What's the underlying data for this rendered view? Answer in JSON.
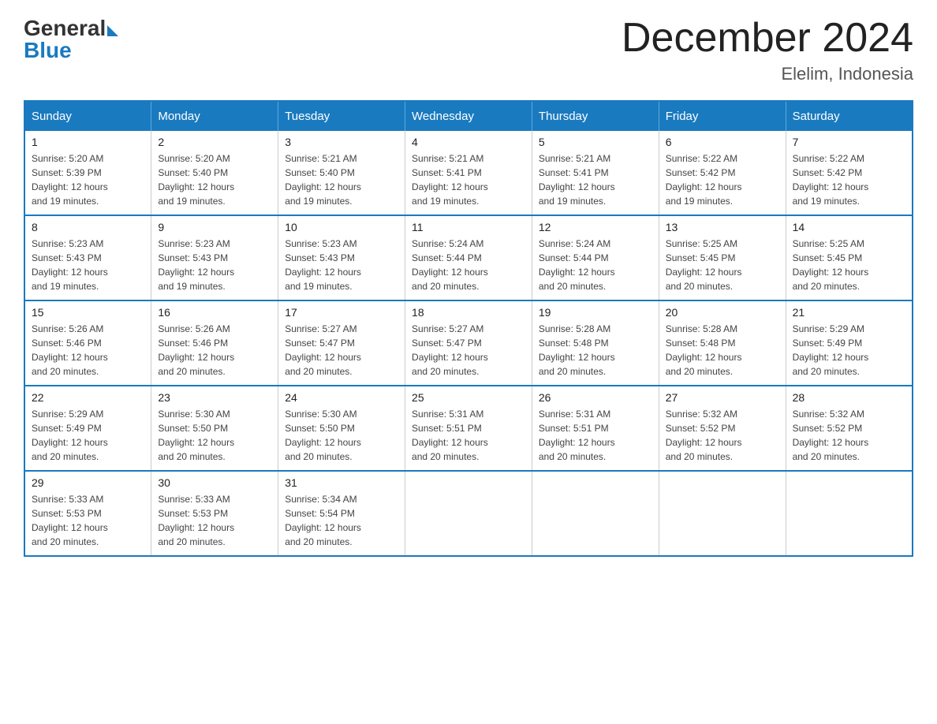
{
  "header": {
    "logo_general": "General",
    "logo_blue": "Blue",
    "title": "December 2024",
    "location": "Elelim, Indonesia"
  },
  "days_of_week": [
    "Sunday",
    "Monday",
    "Tuesday",
    "Wednesday",
    "Thursday",
    "Friday",
    "Saturday"
  ],
  "weeks": [
    [
      {
        "day": "1",
        "sunrise": "5:20 AM",
        "sunset": "5:39 PM",
        "daylight": "12 hours and 19 minutes."
      },
      {
        "day": "2",
        "sunrise": "5:20 AM",
        "sunset": "5:40 PM",
        "daylight": "12 hours and 19 minutes."
      },
      {
        "day": "3",
        "sunrise": "5:21 AM",
        "sunset": "5:40 PM",
        "daylight": "12 hours and 19 minutes."
      },
      {
        "day": "4",
        "sunrise": "5:21 AM",
        "sunset": "5:41 PM",
        "daylight": "12 hours and 19 minutes."
      },
      {
        "day": "5",
        "sunrise": "5:21 AM",
        "sunset": "5:41 PM",
        "daylight": "12 hours and 19 minutes."
      },
      {
        "day": "6",
        "sunrise": "5:22 AM",
        "sunset": "5:42 PM",
        "daylight": "12 hours and 19 minutes."
      },
      {
        "day": "7",
        "sunrise": "5:22 AM",
        "sunset": "5:42 PM",
        "daylight": "12 hours and 19 minutes."
      }
    ],
    [
      {
        "day": "8",
        "sunrise": "5:23 AM",
        "sunset": "5:43 PM",
        "daylight": "12 hours and 19 minutes."
      },
      {
        "day": "9",
        "sunrise": "5:23 AM",
        "sunset": "5:43 PM",
        "daylight": "12 hours and 19 minutes."
      },
      {
        "day": "10",
        "sunrise": "5:23 AM",
        "sunset": "5:43 PM",
        "daylight": "12 hours and 19 minutes."
      },
      {
        "day": "11",
        "sunrise": "5:24 AM",
        "sunset": "5:44 PM",
        "daylight": "12 hours and 20 minutes."
      },
      {
        "day": "12",
        "sunrise": "5:24 AM",
        "sunset": "5:44 PM",
        "daylight": "12 hours and 20 minutes."
      },
      {
        "day": "13",
        "sunrise": "5:25 AM",
        "sunset": "5:45 PM",
        "daylight": "12 hours and 20 minutes."
      },
      {
        "day": "14",
        "sunrise": "5:25 AM",
        "sunset": "5:45 PM",
        "daylight": "12 hours and 20 minutes."
      }
    ],
    [
      {
        "day": "15",
        "sunrise": "5:26 AM",
        "sunset": "5:46 PM",
        "daylight": "12 hours and 20 minutes."
      },
      {
        "day": "16",
        "sunrise": "5:26 AM",
        "sunset": "5:46 PM",
        "daylight": "12 hours and 20 minutes."
      },
      {
        "day": "17",
        "sunrise": "5:27 AM",
        "sunset": "5:47 PM",
        "daylight": "12 hours and 20 minutes."
      },
      {
        "day": "18",
        "sunrise": "5:27 AM",
        "sunset": "5:47 PM",
        "daylight": "12 hours and 20 minutes."
      },
      {
        "day": "19",
        "sunrise": "5:28 AM",
        "sunset": "5:48 PM",
        "daylight": "12 hours and 20 minutes."
      },
      {
        "day": "20",
        "sunrise": "5:28 AM",
        "sunset": "5:48 PM",
        "daylight": "12 hours and 20 minutes."
      },
      {
        "day": "21",
        "sunrise": "5:29 AM",
        "sunset": "5:49 PM",
        "daylight": "12 hours and 20 minutes."
      }
    ],
    [
      {
        "day": "22",
        "sunrise": "5:29 AM",
        "sunset": "5:49 PM",
        "daylight": "12 hours and 20 minutes."
      },
      {
        "day": "23",
        "sunrise": "5:30 AM",
        "sunset": "5:50 PM",
        "daylight": "12 hours and 20 minutes."
      },
      {
        "day": "24",
        "sunrise": "5:30 AM",
        "sunset": "5:50 PM",
        "daylight": "12 hours and 20 minutes."
      },
      {
        "day": "25",
        "sunrise": "5:31 AM",
        "sunset": "5:51 PM",
        "daylight": "12 hours and 20 minutes."
      },
      {
        "day": "26",
        "sunrise": "5:31 AM",
        "sunset": "5:51 PM",
        "daylight": "12 hours and 20 minutes."
      },
      {
        "day": "27",
        "sunrise": "5:32 AM",
        "sunset": "5:52 PM",
        "daylight": "12 hours and 20 minutes."
      },
      {
        "day": "28",
        "sunrise": "5:32 AM",
        "sunset": "5:52 PM",
        "daylight": "12 hours and 20 minutes."
      }
    ],
    [
      {
        "day": "29",
        "sunrise": "5:33 AM",
        "sunset": "5:53 PM",
        "daylight": "12 hours and 20 minutes."
      },
      {
        "day": "30",
        "sunrise": "5:33 AM",
        "sunset": "5:53 PM",
        "daylight": "12 hours and 20 minutes."
      },
      {
        "day": "31",
        "sunrise": "5:34 AM",
        "sunset": "5:54 PM",
        "daylight": "12 hours and 20 minutes."
      },
      null,
      null,
      null,
      null
    ]
  ]
}
